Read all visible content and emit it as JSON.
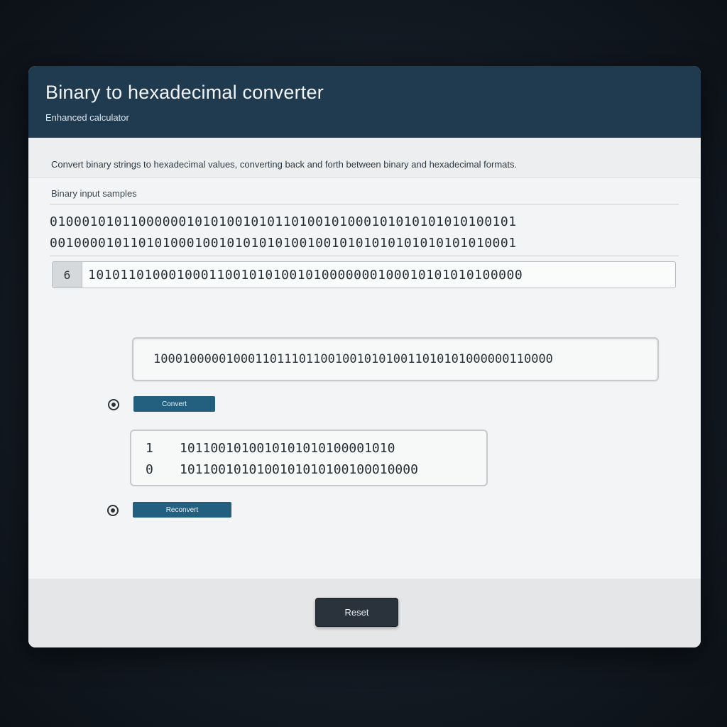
{
  "window": {
    "title": "Binary to hexadecimal converter",
    "subtitle": "Enhanced calculator"
  },
  "description": "Convert binary strings to hexadecimal values, converting back and forth between binary and hexadecimal formats.",
  "input": {
    "label": "Binary input samples",
    "lines": [
      "0100010101100000010101001010110100101000101010101010100101",
      "0010000101101010001001010101010010010101010101010101010001"
    ]
  },
  "bit_row": {
    "tag": "6",
    "value": "101011010001000110010101001010000000100010101010100000"
  },
  "output": {
    "value": "1000100000100011011101100100101010011010101000000110000"
  },
  "convert_button": {
    "label": "Convert"
  },
  "results": [
    {
      "index": "1",
      "value": "1011001010010101010100001010"
    },
    {
      "index": "0",
      "value": "1011001010100101010100100010000"
    }
  ],
  "secondary_button": {
    "label": "Reconvert"
  },
  "footer": {
    "button_label": "Reset"
  },
  "colors": {
    "header": "#203a4f",
    "accent": "#23607f",
    "footer_button": "#2a333c"
  }
}
